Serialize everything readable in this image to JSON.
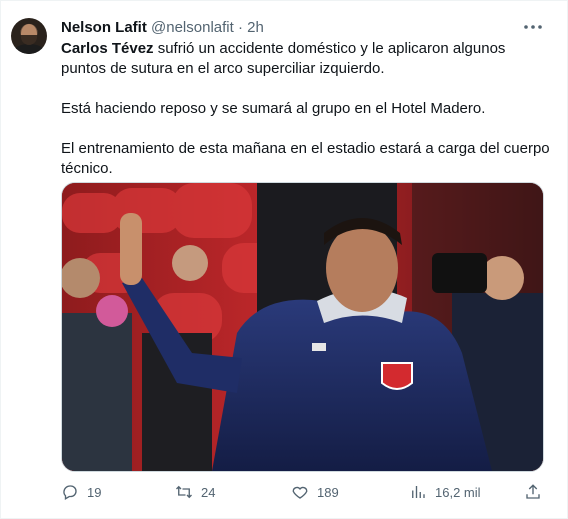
{
  "author": {
    "name": "Nelson Lafit",
    "handle": "@nelsonlafit",
    "separator": "·",
    "time": "2h"
  },
  "menu_icon": "more-horizontal-icon",
  "tweet": {
    "bold_name": "Carlos Tévez",
    "line1_rest": " sufrió un accidente doméstico y le aplicaron algunos puntos de sutura en el arco superciliar izquierdo.",
    "paragraph2": "Está haciendo reposo y se sumará al grupo en el Hotel Madero.",
    "paragraph3": "El entrenamiento de esta mañana en el estadio estará a carga del cuerpo técnico."
  },
  "actions": {
    "replies": "19",
    "retweets": "24",
    "likes": "189",
    "views": "16,2 mil"
  },
  "icons": {
    "reply": "reply-icon",
    "retweet": "retweet-icon",
    "like": "heart-icon",
    "views": "views-icon",
    "share": "share-icon"
  },
  "colors": {
    "text": "#0f1419",
    "muted": "#536471",
    "border": "#eff3f4"
  }
}
